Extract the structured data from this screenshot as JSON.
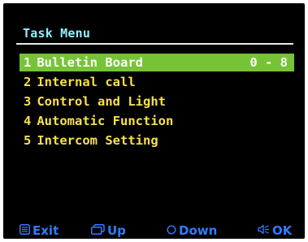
{
  "header": {
    "title": "Task Menu"
  },
  "menu": {
    "items": [
      {
        "number": "1",
        "label": "Bulletin Board",
        "range": "0 - 8",
        "selected": true
      },
      {
        "number": "2",
        "label": "Internal call"
      },
      {
        "number": "3",
        "label": "Control and Light"
      },
      {
        "number": "4",
        "label": "Automatic Function"
      },
      {
        "number": "5",
        "label": "Intercom Setting"
      }
    ]
  },
  "footer": {
    "exit": {
      "label": "Exit",
      "icon": "menu-lines-icon"
    },
    "up": {
      "label": "Up",
      "icon": "stacked-windows-icon"
    },
    "down": {
      "label": "Down",
      "icon": "circle-icon"
    },
    "ok": {
      "label": "OK",
      "icon": "speaker-icon"
    }
  },
  "colors": {
    "background": "#000000",
    "title": "#8ff0ff",
    "item_text": "#f7e04a",
    "selected_bg": "#76c338",
    "selected_text": "#ffffff",
    "footer": "#2f7cff"
  }
}
